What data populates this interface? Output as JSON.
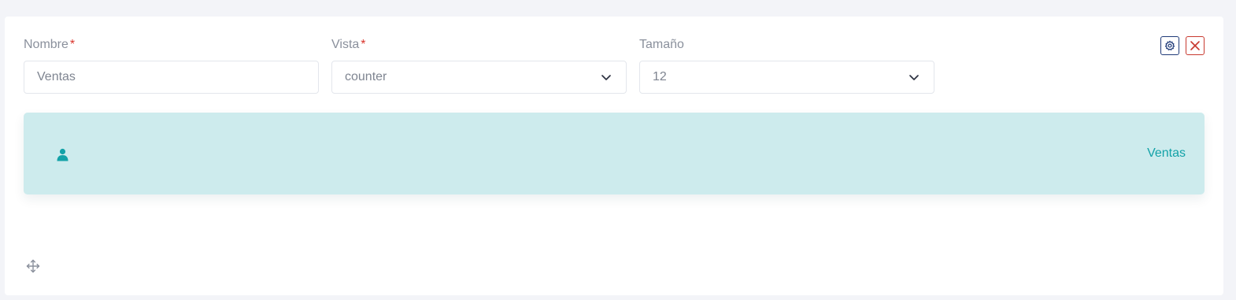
{
  "form": {
    "nombre": {
      "label": "Nombre",
      "required_mark": "*",
      "value": "Ventas"
    },
    "vista": {
      "label": "Vista",
      "required_mark": "*",
      "selected": "counter"
    },
    "tamano": {
      "label": "Tamaño",
      "selected": "12"
    }
  },
  "actions": {
    "settings_icon": "gear-icon",
    "close_icon": "close-icon"
  },
  "counter_card": {
    "icon": "user-icon",
    "label": "Ventas"
  },
  "drag_handle_icon": "move-icon",
  "colors": {
    "background": "#f3f4f8",
    "card": "#ffffff",
    "required": "#d9342b",
    "counter_bg": "#cdebed",
    "accent_teal": "#13a2a8",
    "settings_border": "#1f3a78",
    "close_border": "#c8392f"
  }
}
